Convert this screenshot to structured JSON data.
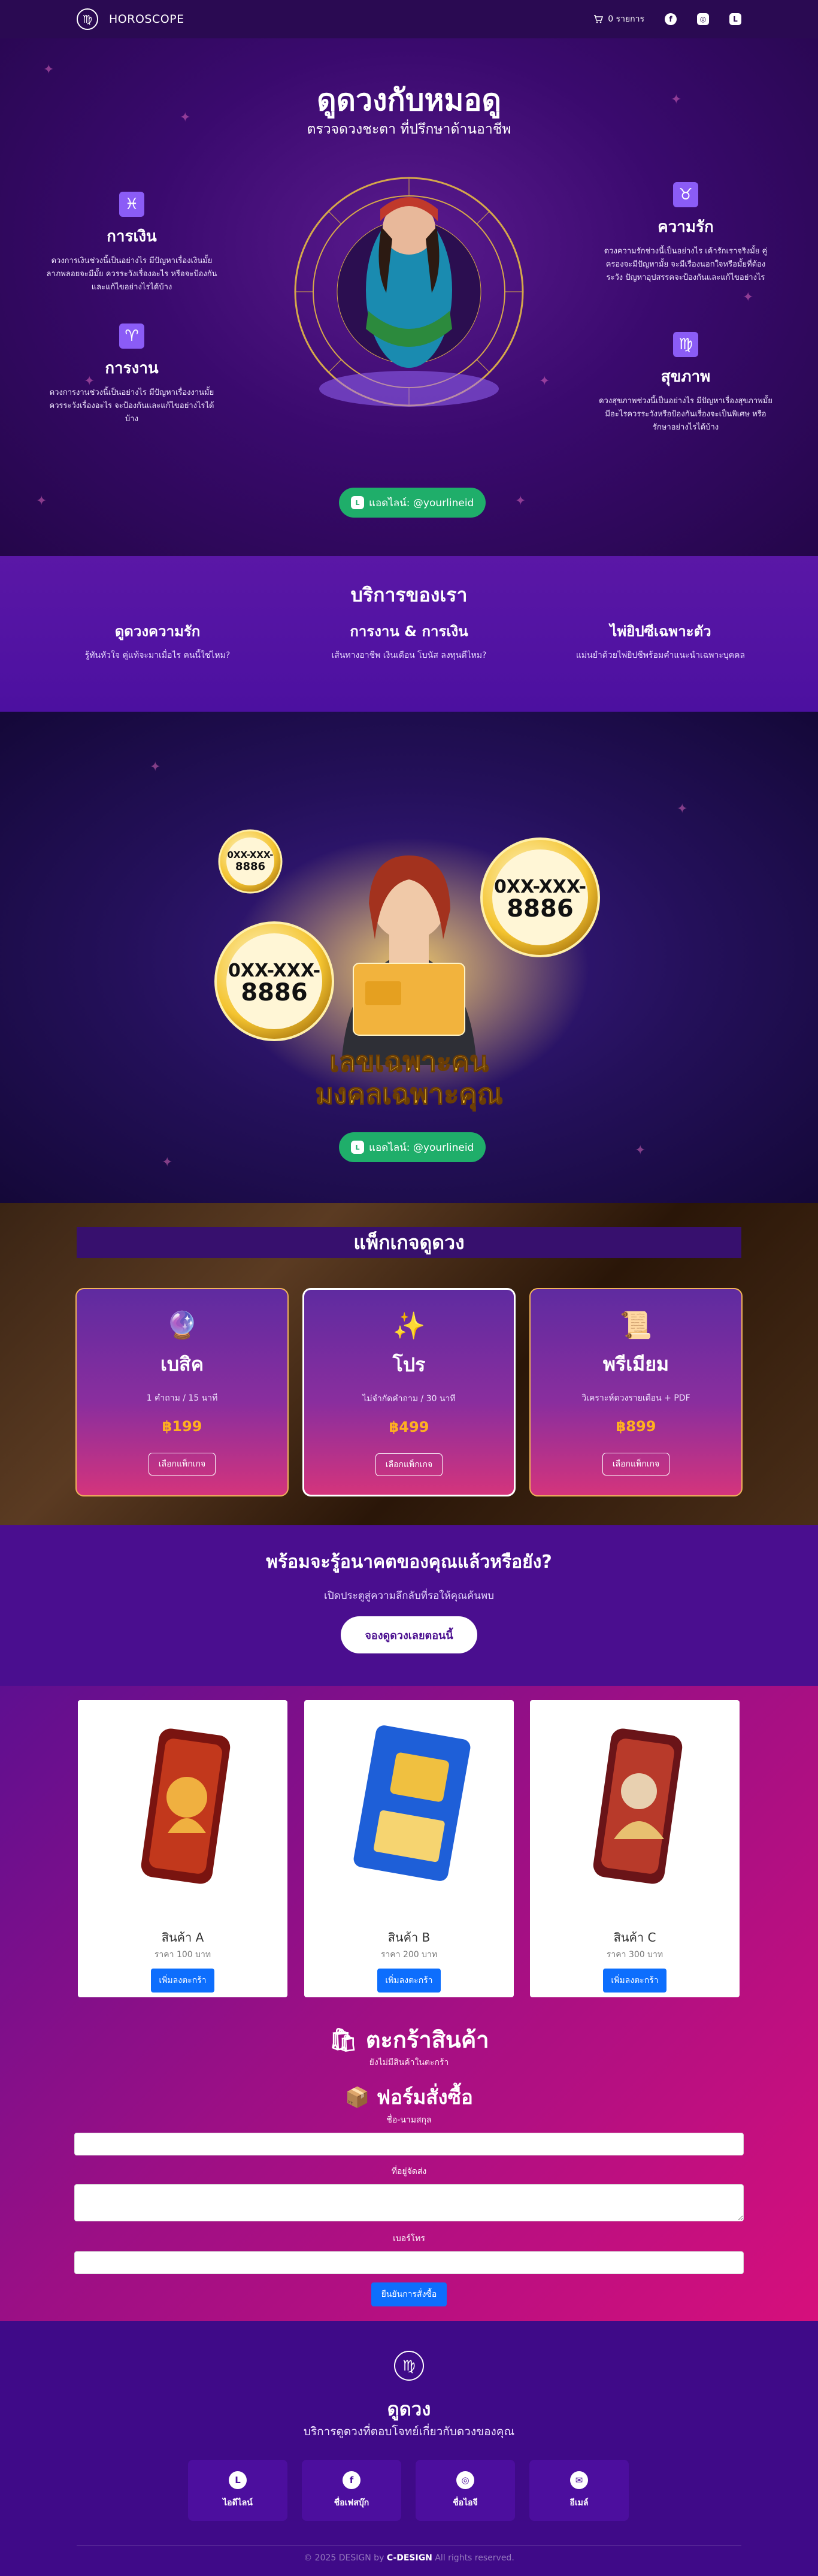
{
  "nav": {
    "brand": "HOROSCOPE",
    "logo_glyph": "♍",
    "cart_label": "0 รายการ",
    "cart_icon": "cart-icon",
    "social_icons": [
      "facebook-icon",
      "instagram-icon",
      "line-icon"
    ]
  },
  "hero": {
    "title": "ดูดวงกับหมอดู",
    "subtitle": "ตรวจดวงชะตา ที่ปรึกษาด้านอาชีพ",
    "features": [
      {
        "title": "การเงิน",
        "desc": "ดวงการเงินช่วงนี้เป็นอย่างไร มีปัญหาเรื่องเงินมั้ย ลาภพลอยจะมีมั้ย ควรระวังเรื่องอะไร หรือจะป้องกันและแก้ไขอย่างไรได้บ้าง",
        "icon": "♓"
      },
      {
        "title": "การงาน",
        "desc": "ดวงการงานช่วงนี้เป็นอย่างไร มีปัญหาเรื่องงานมั้ย ควรระวังเรื่องอะไร จะป้องกันและแก้ไขอย่างไรได้บ้าง",
        "icon": "♈"
      },
      {
        "title": "ความรัก",
        "desc": "ดวงความรักช่วงนี้เป็นอย่างไร เค้ารักเราจริงมั้ย คู่ครองจะมีปัญหามั้ย จะมีเรื่องนอกใจหรือมั้ยที่ต้องระวัง ปัญหาอุปสรรคจะป้องกันและแก้ไขอย่างไร",
        "icon": "♉"
      },
      {
        "title": "สุขภาพ",
        "desc": "ดวงสุขภาพช่วงนี้เป็นอย่างไร มีปัญหาเรื่องสุขภาพมั้ย มีอะไรควรระวังหรือป้องกันเรื่องจะเป็นพิเศษ หรือรักษาอย่างไรได้บ้าง",
        "icon": "♍"
      }
    ],
    "line_button": "แอดไลน์: @yourlineid"
  },
  "services": {
    "title": "บริการของเรา",
    "items": [
      {
        "title": "ดูดวงความรัก",
        "desc": "รู้ทันหัวใจ คู่แท้จะมาเมื่อไร คนนี้ใช่ไหม?"
      },
      {
        "title": "การงาน & การเงิน",
        "desc": "เส้นทางอาชีพ เงินเดือน โบนัส ลงทุนดีไหม?"
      },
      {
        "title": "ไพ่ยิปซีเฉพาะตัว",
        "desc": "แม่นยำด้วยไพ่ยิปซีพร้อมคำแนะนำเฉพาะบุคคล"
      }
    ]
  },
  "lucky": {
    "number_text": "0XX-XXX-8886",
    "number_line1": "0XX-XXX-",
    "number_line2": "8886",
    "banner_line1": "เลขเฉพาะคน",
    "banner_line2": "มงคลเฉพาะคุณ",
    "line_button": "แอดไลน์: @yourlineid"
  },
  "packages": {
    "title": "แพ็กเกจดูดวง",
    "items": [
      {
        "name": "เบสิค",
        "desc": "1 คำถาม / 15 นาที",
        "price": "฿199",
        "button": "เลือกแพ็กเกจ",
        "icon": "🔮"
      },
      {
        "name": "โปร",
        "desc": "ไม่จำกัดคำถาม / 30 นาที",
        "price": "฿499",
        "button": "เลือกแพ็กเกจ",
        "icon": "✨"
      },
      {
        "name": "พรีเมียม",
        "desc": "วิเคราะห์ดวงรายเดือน + PDF",
        "price": "฿899",
        "button": "เลือกแพ็กเกจ",
        "icon": "📜"
      }
    ]
  },
  "cta": {
    "title": "พร้อมจะรู้อนาคตของคุณแล้วหรือยัง?",
    "desc": "เปิดประตูสู่ความลึกลับที่รอให้คุณค้นพบ",
    "button": "จองดูดวงเลยตอนนี้"
  },
  "shop": {
    "products": [
      {
        "name": "สินค้า A",
        "price": "ราคา 100 บาท",
        "button": "เพิ่มลงตะกร้า"
      },
      {
        "name": "สินค้า B",
        "price": "ราคา 200 บาท",
        "button": "เพิ่มลงตะกร้า"
      },
      {
        "name": "สินค้า C",
        "price": "ราคา 300 บาท",
        "button": "เพิ่มลงตะกร้า"
      }
    ],
    "cart_title": "🛍 ตะกร้าสินค้า",
    "cart_empty": "ยังไม่มีสินค้าในตะกร้า",
    "form_title": "📦 ฟอร์มสั่งซื้อ",
    "fields": {
      "name_label": "ชื่อ-นามสกุล",
      "address_label": "ที่อยู่จัดส่ง",
      "phone_label": "เบอร์โทร",
      "name_value": "",
      "address_value": "",
      "phone_value": ""
    },
    "submit": "ยืนยันการสั่งซื้อ"
  },
  "footer": {
    "logo_glyph": "♍",
    "title": "ดูดวง",
    "subtitle": "บริการดูดวงที่ตอบโจทย์เกี่ยวกับดวงของคุณ",
    "socials": [
      {
        "label": "ไอดีไลน์",
        "icon": "line-icon",
        "glyph": "L"
      },
      {
        "label": "ชื่อเฟสบุ๊ก",
        "icon": "facebook-icon",
        "glyph": "f"
      },
      {
        "label": "ชื่อไอจี",
        "icon": "instagram-icon",
        "glyph": "◎"
      },
      {
        "label": "อีเมล์",
        "icon": "mail-icon",
        "glyph": "✉"
      }
    ],
    "copy_prefix": "© 2025 DESIGN by",
    "copy_brand": "C-DESIGN",
    "copy_suffix": "All rights reserved."
  },
  "colors": {
    "nav_bg": "#2a0a52",
    "line_green": "#1fae6a",
    "price_gold": "#ffb020",
    "button_blue": "#0d6efd"
  }
}
